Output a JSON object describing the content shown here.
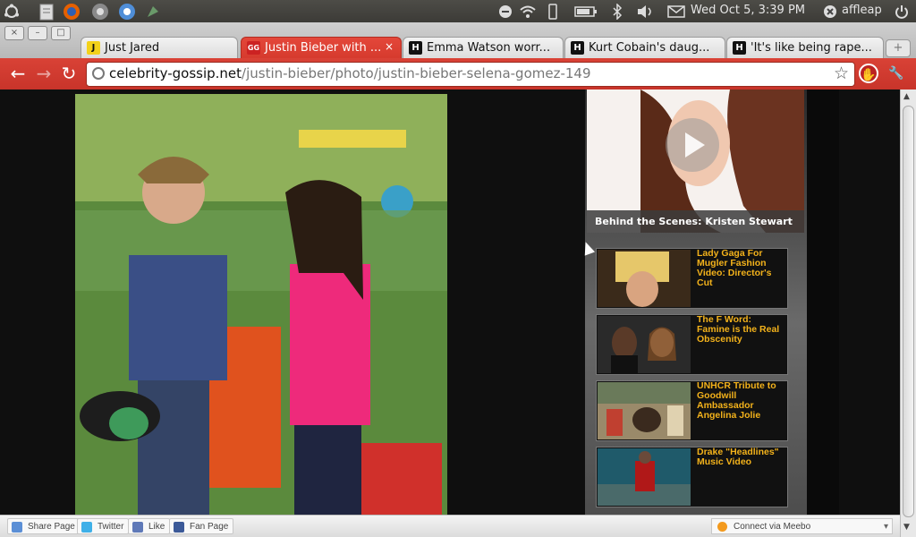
{
  "panel": {
    "datetime": "Wed Oct  5,  3:39 PM",
    "user": "affleap",
    "launcher_icons": [
      "ubuntu-logo-icon",
      "text-editor-icon",
      "firefox-icon",
      "app-icon",
      "chrome-icon",
      "settings-icon"
    ],
    "indicator_icons": [
      "network-off-icon",
      "wifi-icon",
      "phone-icon",
      "battery-icon",
      "bluetooth-icon",
      "volume-icon",
      "mail-icon"
    ]
  },
  "window": {
    "tabs": [
      {
        "label": "Just Jared",
        "favicon": "J",
        "active": false
      },
      {
        "label": "Justin Bieber with ...",
        "favicon": "GG",
        "active": true
      },
      {
        "label": "Emma Watson worr...",
        "favicon": "H",
        "active": false
      },
      {
        "label": "Kurt Cobain's daug...",
        "favicon": "H",
        "active": false
      },
      {
        "label": "'It's like being rape...",
        "favicon": "H",
        "active": false
      }
    ],
    "close_glyph": "×",
    "newtab_glyph": "+"
  },
  "toolbar": {
    "back_glyph": "←",
    "forward_glyph": "→",
    "reload_glyph": "↻",
    "url_host": "celebrity-gossip.net",
    "url_path": "/justin-bieber/photo/justin-bieber-selena-gomez-149",
    "star_glyph": "☆"
  },
  "sidebar": {
    "featured_caption": "Behind the Scenes: Kristen Stewart",
    "videos": [
      {
        "title": "Lady Gaga For Mugler Fashion Video: Director's Cut"
      },
      {
        "title": "The F Word: Famine is the Real Obscenity"
      },
      {
        "title": "UNHCR Tribute to Goodwill Ambassador Angelina Jolie"
      },
      {
        "title": "Drake \"Headlines\" Music Video"
      }
    ]
  },
  "bottombar": {
    "share": "Share Page",
    "twitter": "Twitter",
    "like": "Like",
    "fanpage": "Fan Page",
    "meebo": "Connect via Meebo"
  },
  "colors": {
    "chrome_red": "#d53a2d",
    "video_title": "#f3b21b"
  }
}
